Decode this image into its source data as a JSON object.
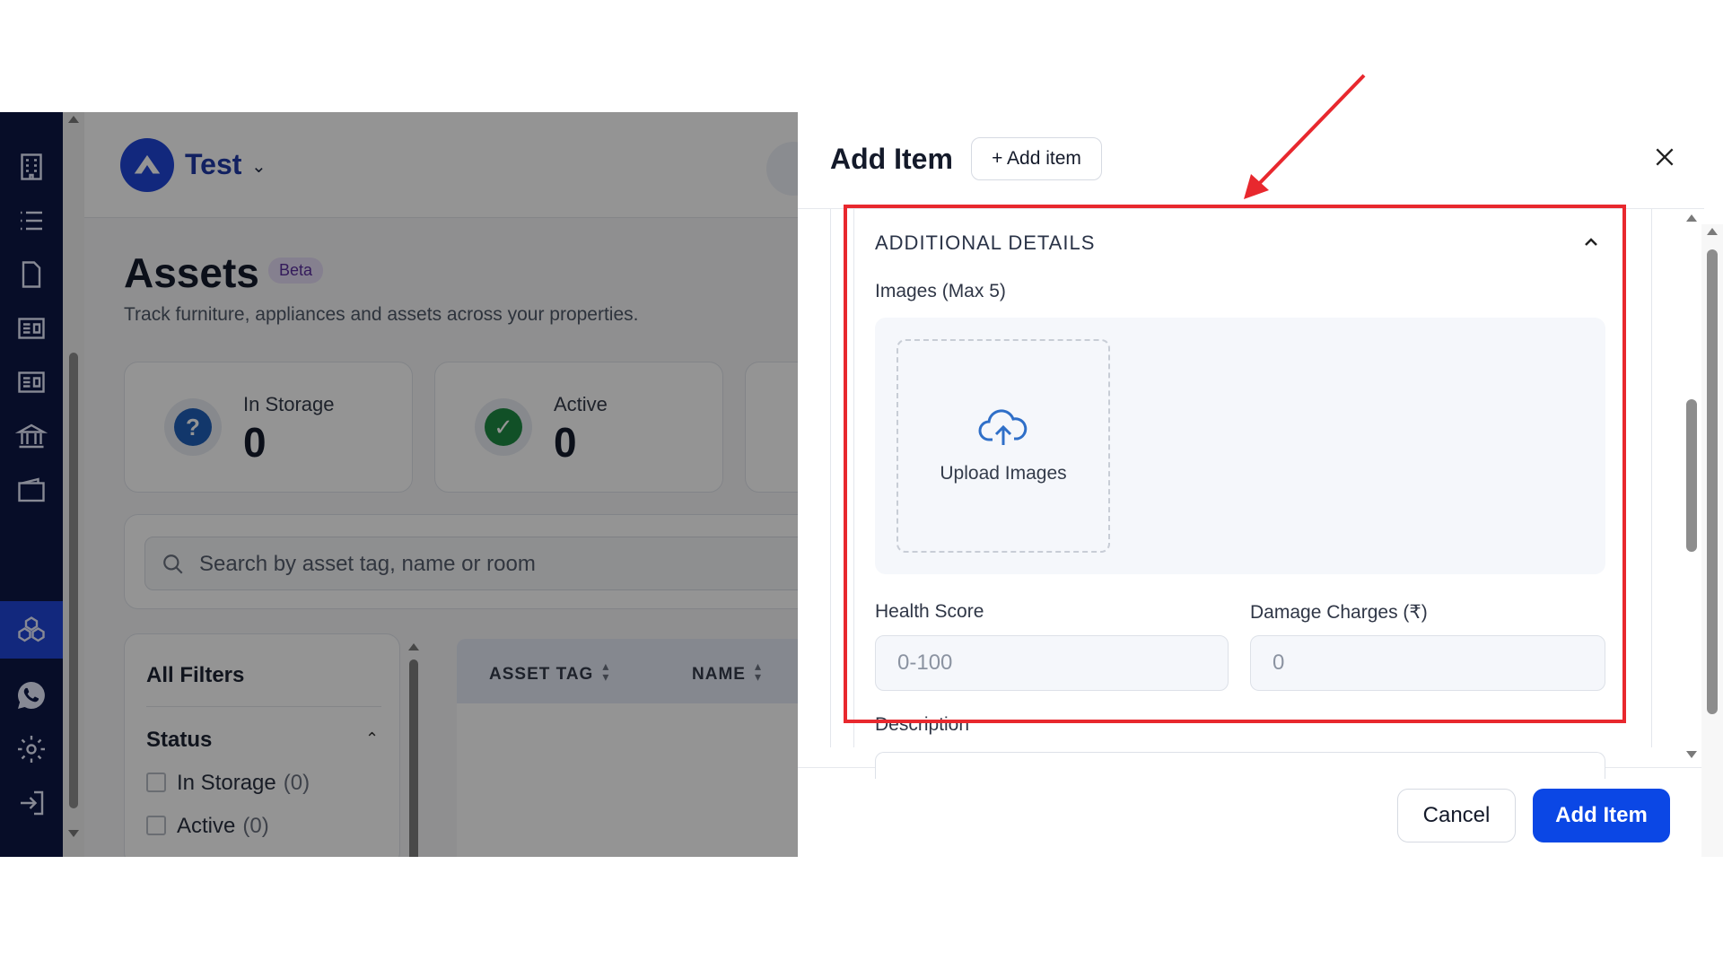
{
  "app": {
    "org_name": "Test",
    "page_title": "Assets",
    "beta_badge": "Beta",
    "subtitle": "Track furniture, appliances and assets across your properties.",
    "stats": [
      {
        "label": "In Storage",
        "value": "0",
        "icon": "question-icon",
        "color": "#1f5fb8"
      },
      {
        "label": "Active",
        "value": "0",
        "icon": "check-icon",
        "color": "#1e8a44"
      }
    ],
    "search_placeholder": "Search by asset tag, name or room",
    "filters": {
      "title": "All Filters",
      "status_label": "Status",
      "options": [
        {
          "label": "In Storage",
          "count": "(0)"
        },
        {
          "label": "Active",
          "count": "(0)"
        }
      ]
    },
    "table_headers": [
      "ASSET TAG",
      "NAME"
    ],
    "rail_icons": [
      "building-icon",
      "list-icon",
      "document-icon",
      "invoice-icon",
      "invoice-icon",
      "bank-icon",
      "wallet-icon",
      "assets-icon",
      "whatsapp-icon",
      "settings-icon",
      "logout-icon"
    ],
    "active_rail_icon": "assets-icon"
  },
  "drawer": {
    "title": "Add Item",
    "add_item_button": "+ Add item",
    "section_title": "ADDITIONAL DETAILS",
    "images_label": "Images (Max 5)",
    "upload_label": "Upload Images",
    "health_score_label": "Health Score",
    "health_score_placeholder": "0-100",
    "damage_charges_label": "Damage Charges (₹)",
    "damage_charges_placeholder": "0",
    "description_label": "Description",
    "cancel_label": "Cancel",
    "submit_label": "Add Item"
  },
  "colors": {
    "primary": "#0b47e5",
    "rail_bg": "#0d1846",
    "annotation": "#e8282e"
  }
}
